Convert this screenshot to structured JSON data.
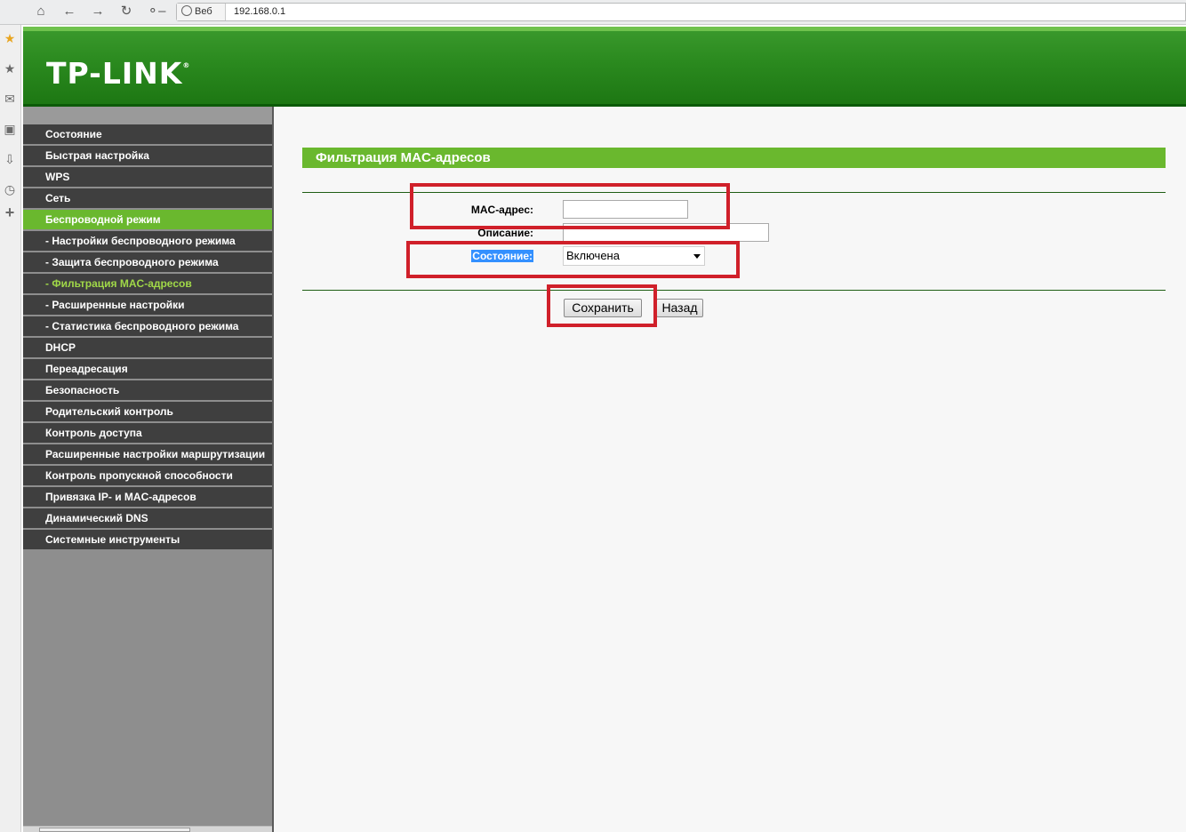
{
  "browser": {
    "web_chip": "Веб",
    "url": "192.168.0.1"
  },
  "router": {
    "logo": "TP-LINK",
    "logo_mark": "®"
  },
  "nav": {
    "items": [
      {
        "label": "Состояние"
      },
      {
        "label": "Быстрая настройка"
      },
      {
        "label": "WPS"
      },
      {
        "label": "Сеть"
      },
      {
        "label": "Беспроводной режим"
      },
      {
        "label": "- Настройки беспроводного режима"
      },
      {
        "label": "- Защита беспроводного режима"
      },
      {
        "label": "- Фильтрация MAC-адресов"
      },
      {
        "label": "- Расширенные настройки"
      },
      {
        "label": "- Статистика беспроводного режима"
      },
      {
        "label": "DHCP"
      },
      {
        "label": "Переадресация"
      },
      {
        "label": "Безопасность"
      },
      {
        "label": "Родительский контроль"
      },
      {
        "label": "Контроль доступа"
      },
      {
        "label": "Расширенные настройки маршрутизации"
      },
      {
        "label": "Контроль пропускной способности"
      },
      {
        "label": "Привязка IP- и MAC-адресов"
      },
      {
        "label": "Динамический DNS"
      },
      {
        "label": "Системные инструменты"
      }
    ]
  },
  "main": {
    "title": "Фильтрация MAC-адресов",
    "form": {
      "mac_label": "MAC-адрес:",
      "mac_value": "",
      "desc_label": "Описание:",
      "desc_value": "",
      "status_label": "Состояние:",
      "status_value": "Включена"
    },
    "save_button": "Сохранить",
    "back_button": "Назад"
  },
  "colors": {
    "accent_green": "#6ab82e",
    "header_green": "#2b8a1f",
    "highlight_red": "#d0202a",
    "nav_dark": "#3f3f3f"
  }
}
